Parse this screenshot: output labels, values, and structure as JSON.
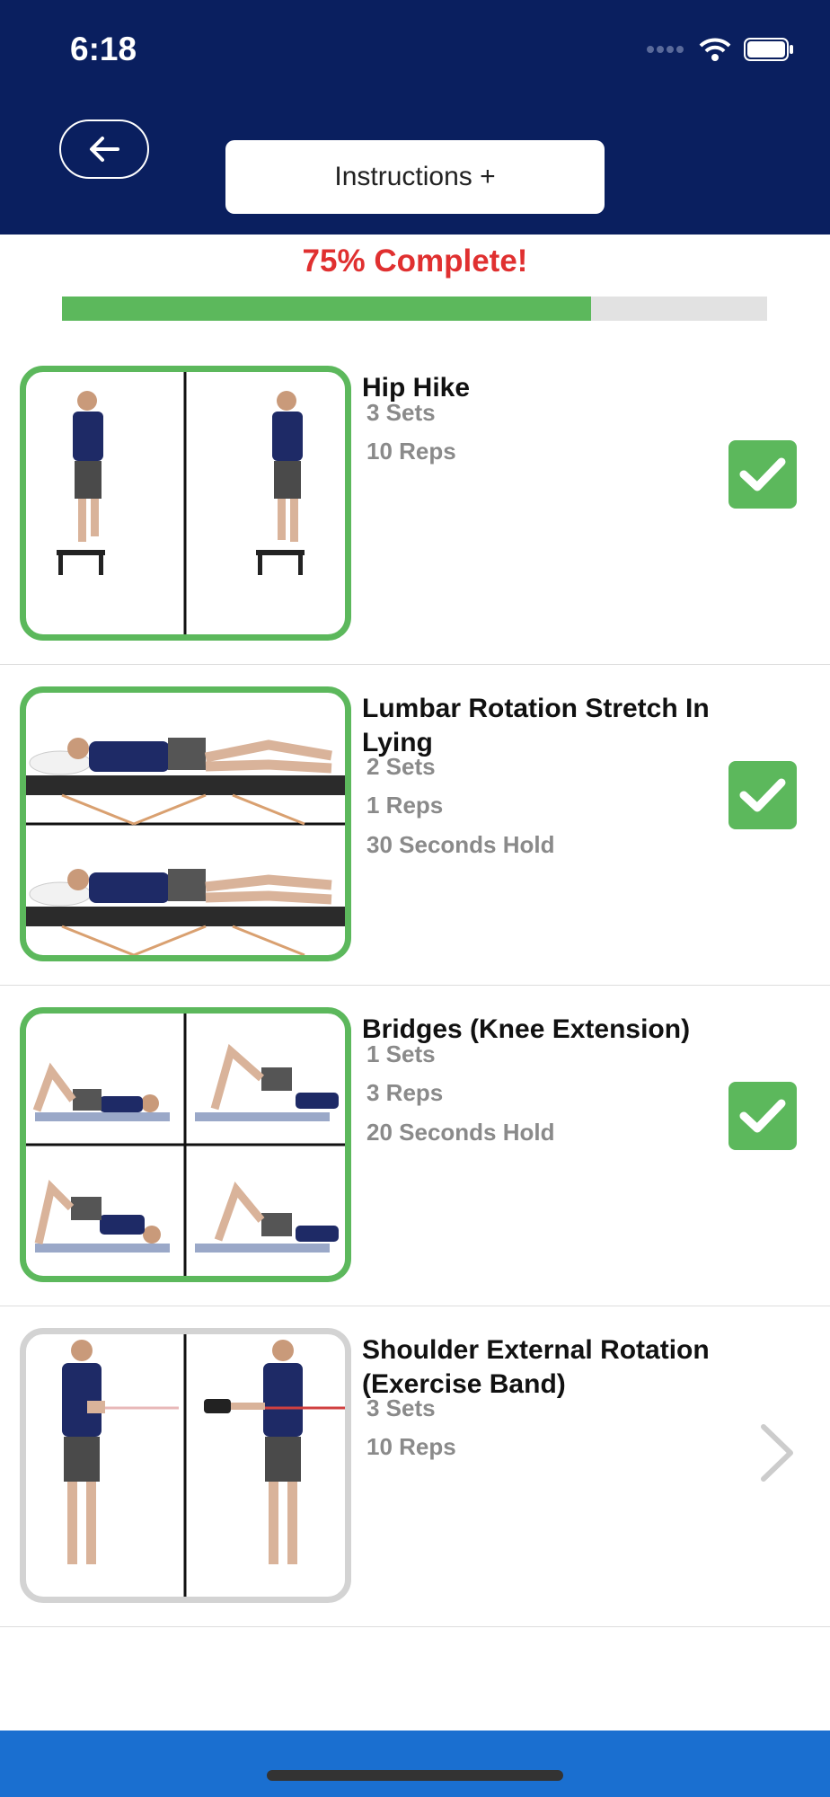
{
  "status_bar": {
    "time": "6:18"
  },
  "header": {
    "instructions_label": "Instructions +"
  },
  "progress": {
    "label": "75% Complete!",
    "fraction": 0.75,
    "color": "#5cb85c"
  },
  "exercises": [
    {
      "title": "Hip Hike",
      "details": [
        "3 Sets",
        "10 Reps"
      ],
      "completed": true,
      "image_icon": "hip-hike-illustration"
    },
    {
      "title": "Lumbar Rotation Stretch In Lying",
      "details": [
        "2 Sets",
        "1 Reps",
        "30 Seconds Hold"
      ],
      "completed": true,
      "image_icon": "lumbar-rotation-illustration"
    },
    {
      "title": "Bridges (Knee Extension)",
      "details": [
        "1 Sets",
        "3 Reps",
        "20 Seconds Hold"
      ],
      "completed": true,
      "image_icon": "bridges-illustration"
    },
    {
      "title": "Shoulder External Rotation (Exercise Band)",
      "details": [
        "3 Sets",
        "10 Reps"
      ],
      "completed": false,
      "image_icon": "shoulder-rotation-illustration"
    }
  ],
  "colors": {
    "header_bg": "#0a1f5f",
    "accent_green": "#5cb85c",
    "progress_text": "#e03030",
    "bottom_bar": "#1a6fd0"
  }
}
